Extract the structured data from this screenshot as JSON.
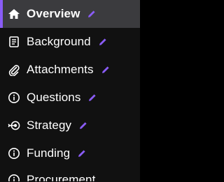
{
  "colors": {
    "background": "#111111",
    "active_background": "#3b3b3e",
    "active_indicator": "#8a5cf6",
    "edit_icon": "#8a5cf6",
    "text": "#ffffff"
  },
  "nav": {
    "items": [
      {
        "label": "Overview",
        "icon": "home-icon",
        "active": true
      },
      {
        "label": "Background",
        "icon": "document-icon",
        "active": false
      },
      {
        "label": "Attachments",
        "icon": "paperclip-icon",
        "active": false
      },
      {
        "label": "Questions",
        "icon": "info-icon",
        "active": false
      },
      {
        "label": "Strategy",
        "icon": "target-icon",
        "active": false
      },
      {
        "label": "Funding",
        "icon": "info-icon",
        "active": false
      },
      {
        "label": "Procurement",
        "icon": "info-icon",
        "active": false
      }
    ]
  }
}
